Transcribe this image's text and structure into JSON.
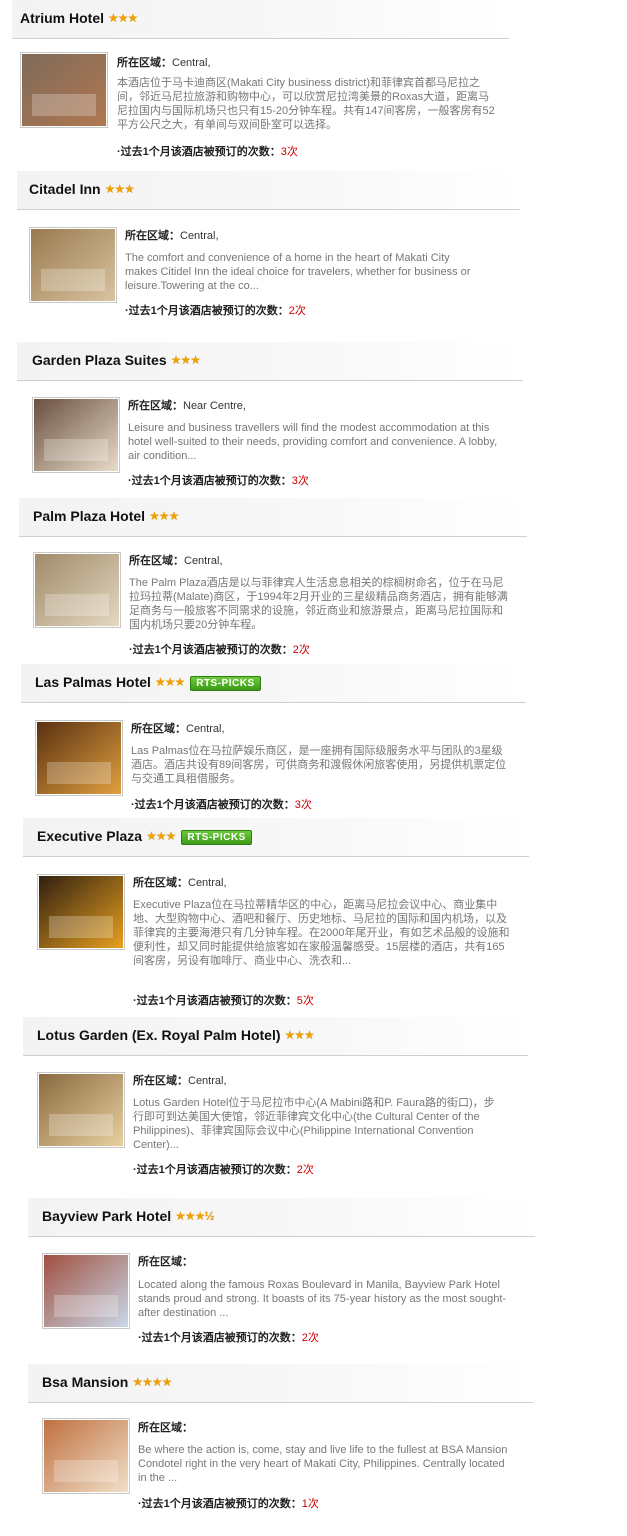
{
  "labels": {
    "region": "所在区域：",
    "bookings": "·过去1个月该酒店被预订的次数：",
    "rts_badge": "RTS-PICKS"
  },
  "hotels": [
    {
      "name": "Atrium Hotel",
      "rating": 3,
      "stars": "★★★",
      "rts": false,
      "region": "Central,",
      "description": "本酒店位于马卡迪商区(Makati City business district)和菲律宾首都马尼拉之间，邻近马尼拉旅游和购物中心，可以欣赏尼拉湾美景的Roxas大道，距离马尼拉国内与国际机场只也只有15-20分钟车程。共有147间客房，一般客房有52平方公尺之大，有单间与双间卧室可以选择。",
      "bookings": "3次",
      "photo_colors": [
        "#7f6a5a",
        "#b07850"
      ]
    },
    {
      "name": "Citadel Inn",
      "rating": 3,
      "stars": "★★★",
      "rts": false,
      "region": "Central,",
      "description": "The comfort and convenience of a home in the heart of Makati City makes Citidel Inn the ideal choice for travelers, whether for business or leisure.Towering at the co...",
      "bookings": "2次",
      "photo_colors": [
        "#9a7a50",
        "#d8c4a0"
      ]
    },
    {
      "name": "Garden Plaza Suites",
      "rating": 3,
      "stars": "★★★",
      "rts": false,
      "region": "Near Centre,",
      "description": "Leisure and business travellers will find the modest accommodation at this hotel well-suited to their needs, providing comfort and convenience. A lobby, air condition...",
      "bookings": "3次",
      "photo_colors": [
        "#6a5040",
        "#e8dcc8"
      ]
    },
    {
      "name": "Palm Plaza Hotel",
      "rating": 3,
      "stars": "★★★",
      "rts": false,
      "region": "Central,",
      "description": "The Palm Plaza酒店是以与菲律宾人生活息息相关的棕榈树命名，位于在马尼拉玛拉蒂(Malate)商区，于1994年2月开业的三星级精品商务酒店，拥有能够满足商务与一般旅客不同需求的设施，邻近商业和旅游景点，距离马尼拉国际和国内机场只要20分钟车程。",
      "bookings": "2次",
      "photo_colors": [
        "#a08a6a",
        "#e4d8c0"
      ]
    },
    {
      "name": "Las Palmas Hotel",
      "rating": 3,
      "stars": "★★★",
      "rts": true,
      "region": "Central,",
      "description": "Las Palmas位在马拉萨娱乐商区，是一座拥有国际级服务水平与团队的3星级酒店。酒店共设有89间客房，可供商务和渡假休闲旅客使用，另提供机票定位与交通工具租借服务。",
      "bookings": "3次",
      "photo_colors": [
        "#5a3010",
        "#e0a040"
      ]
    },
    {
      "name": "Executive Plaza",
      "rating": 3,
      "stars": "★★★",
      "rts": true,
      "region": "Central,",
      "description": "Executive Plaza位在马拉蒂精华区的中心，距离马尼拉会议中心、商业集中地、大型购物中心、酒吧和餐厅、历史地标、马尼拉的国际和国内机场，以及菲律宾的主要海港只有几分钟车程。在2000年尾开业，有如艺术品般的设施和便利性，却又同时能提供给旅客如在家般温馨感受。15层楼的酒店，共有165间客房，另设有咖啡厅、商业中心、洗衣和...",
      "bookings": "5次",
      "photo_colors": [
        "#302010",
        "#e8a020"
      ]
    },
    {
      "name": "Lotus Garden (Ex. Royal Palm Hotel)",
      "rating": 3,
      "stars": "★★★",
      "rts": false,
      "region": "Central,",
      "description": "Lotus Garden Hotel位于马尼拉市中心(A Mabini路和P. Faura路的街口)，步行即可到达美国大使馆，邻近菲律宾文化中心(the Cultural Center of the Philippines)、菲律宾国际会议中心(Philippine International Convention Center)...",
      "bookings": "2次",
      "photo_colors": [
        "#8a6a40",
        "#e8d0a0"
      ]
    },
    {
      "name": "Bayview Park Hotel",
      "rating": 3.5,
      "stars": "★★★½",
      "rts": false,
      "region": "",
      "description": "Located along the famous Roxas Boulevard in Manila, Bayview Park Hotel stands proud and strong. It boasts of its 75-year history as the most sought-after destination ...",
      "bookings": "2次",
      "photo_colors": [
        "#a05040",
        "#c8d8e8"
      ]
    },
    {
      "name": "Bsa Mansion",
      "rating": 4,
      "stars": "★★★★",
      "rts": false,
      "region": "",
      "description": "Be where the action is, come, stay and live life to the fullest at BSA Mansion Condotel right in the very heart of Makati City, Philippines. Centrally located in the ...",
      "bookings": "1次",
      "photo_colors": [
        "#c07040",
        "#f0e0c8"
      ]
    }
  ]
}
